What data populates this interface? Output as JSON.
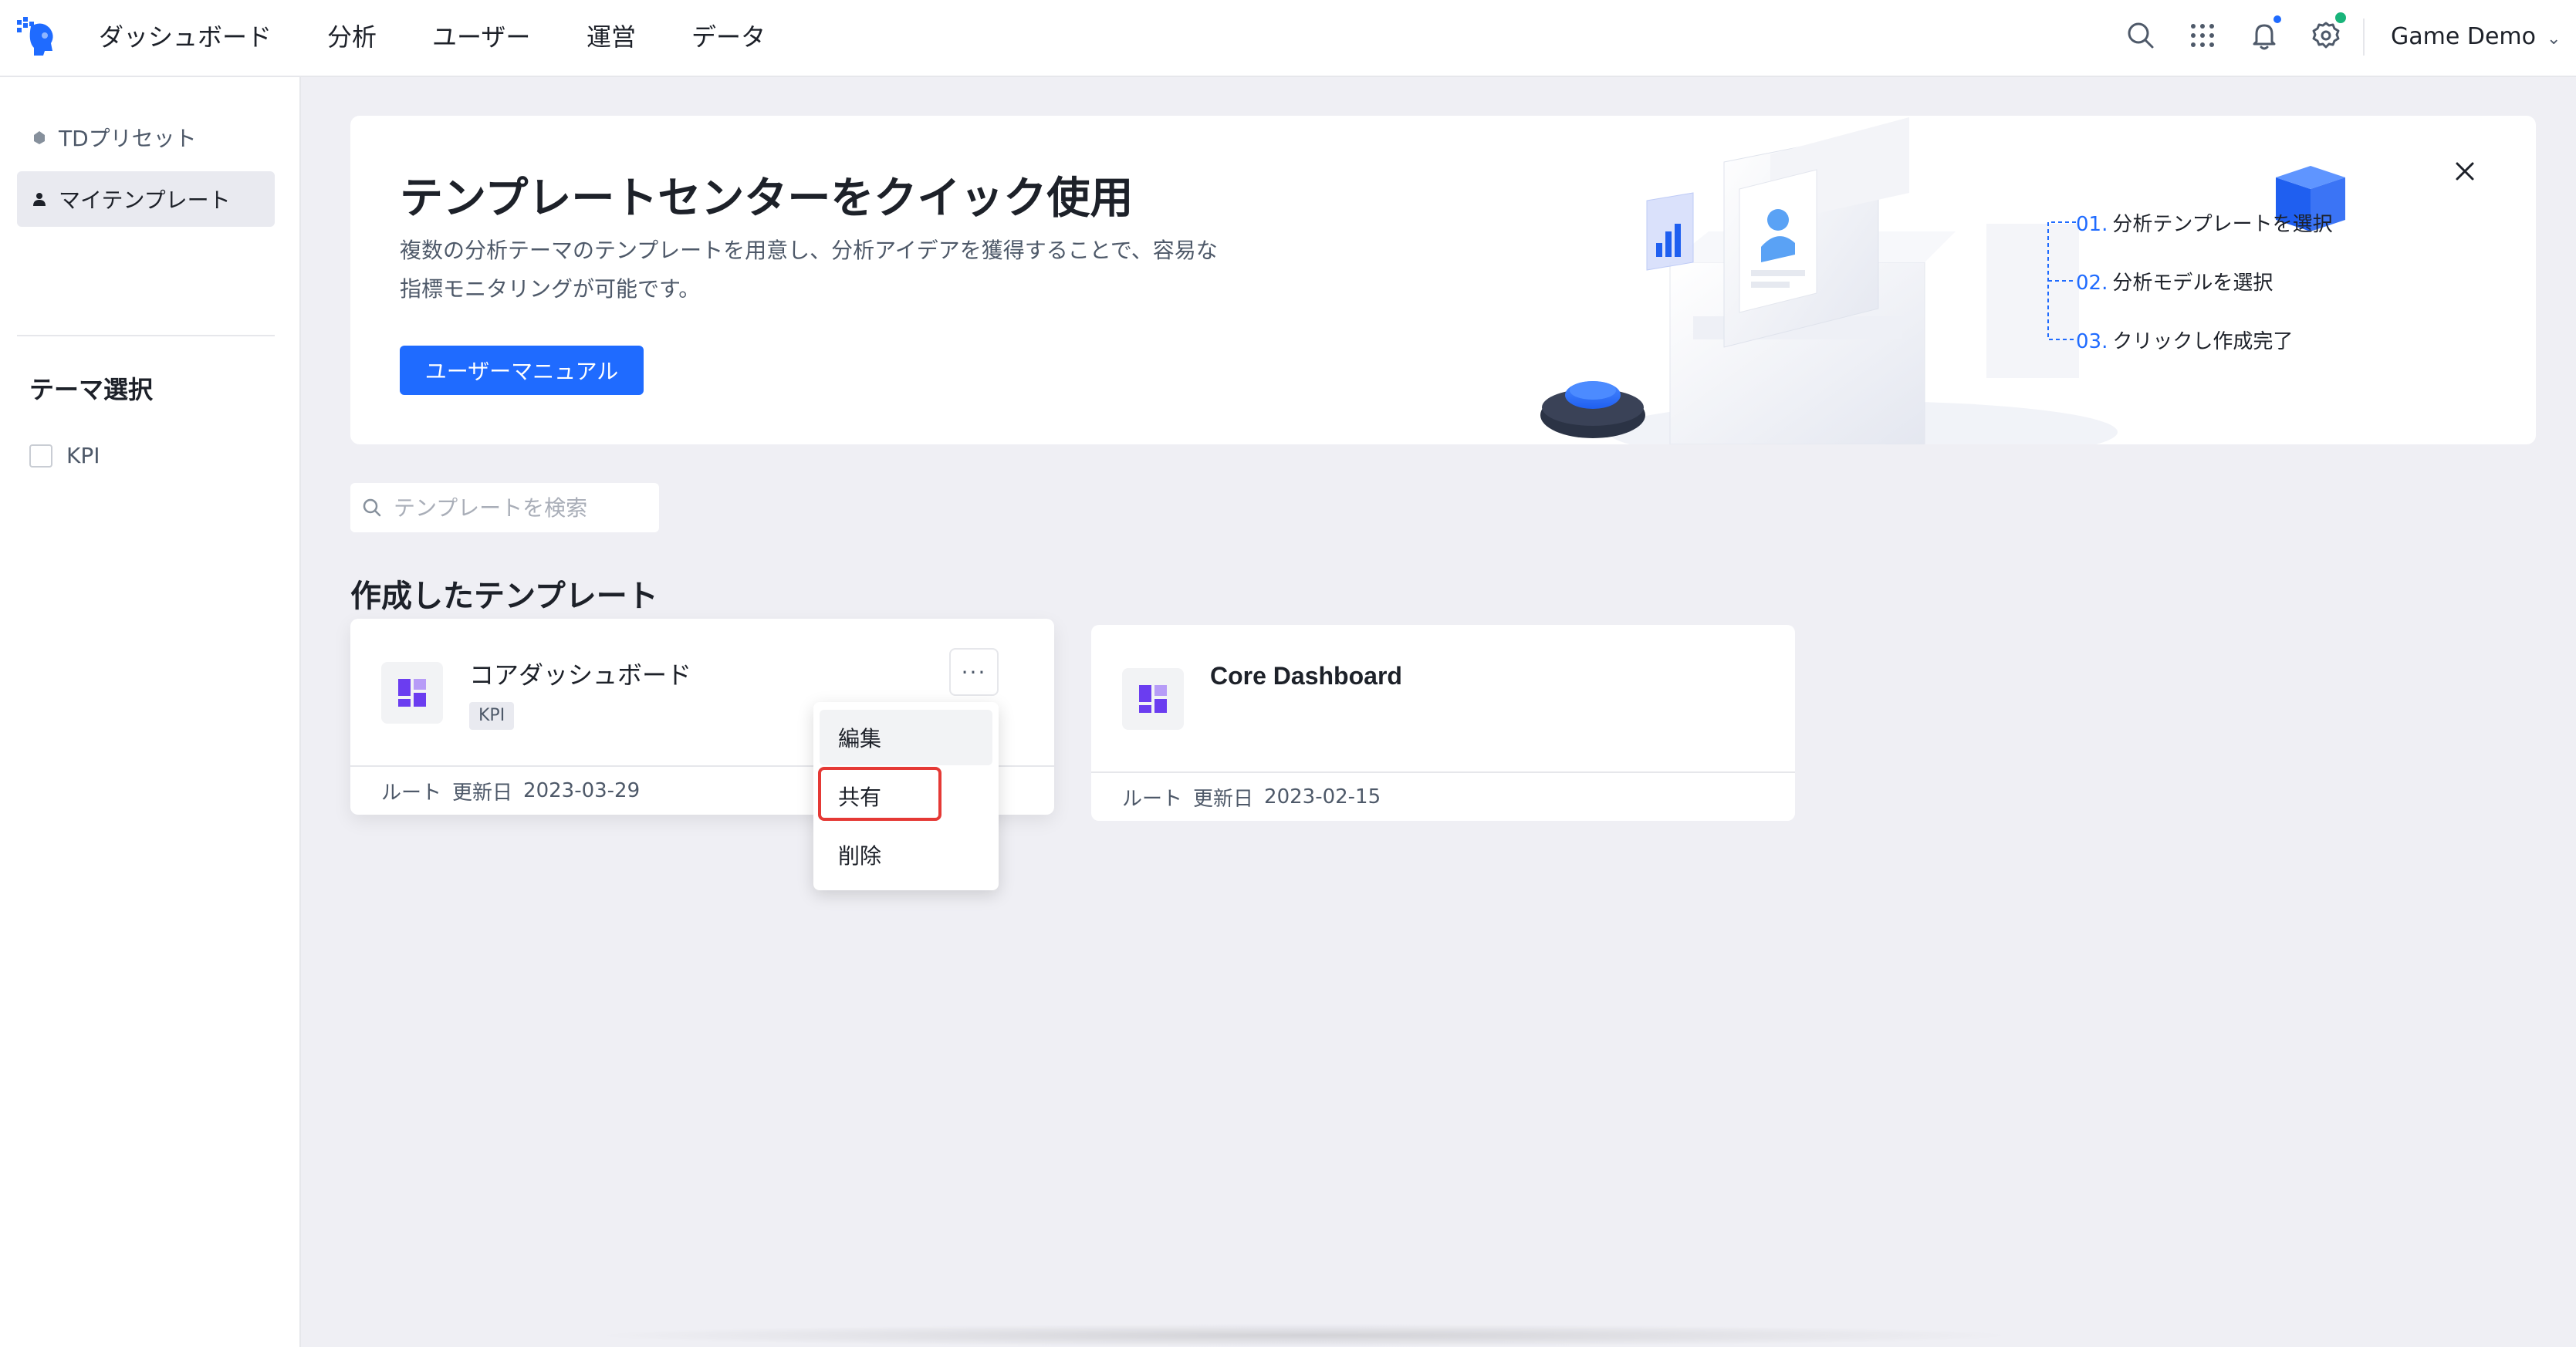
{
  "topbar": {
    "nav": [
      "ダッシュボード",
      "分析",
      "ユーザー",
      "運営",
      "データ"
    ],
    "user_name": "Game Demo",
    "icons": [
      "search-icon",
      "apps-grid-icon",
      "bell-icon",
      "settings-icon"
    ]
  },
  "sidebar": {
    "items": [
      {
        "label": "TDプリセット",
        "icon": "preset-icon"
      },
      {
        "label": "マイテンプレート",
        "icon": "person-icon"
      }
    ],
    "theme_heading": "テーマ選択",
    "theme_options": [
      {
        "label": "KPI",
        "checked": false
      }
    ]
  },
  "banner": {
    "title": "テンプレートセンターをクイック使用",
    "desc_line1": "複数の分析テーマのテンプレートを用意し、分析アイデアを獲得することで、容易な",
    "desc_line2": "指標モニタリングが可能です。",
    "button": "ユーザーマニュアル",
    "steps": [
      {
        "num": "01.",
        "text": "分析テンプレートを選択"
      },
      {
        "num": "02.",
        "text": "分析モデルを選択"
      },
      {
        "num": "03.",
        "text": "クリックし作成完了"
      }
    ]
  },
  "search": {
    "placeholder": "テンプレートを検索"
  },
  "section_title": "作成したテンプレート",
  "cards": [
    {
      "title": "コアダッシュボード",
      "tag": "KPI",
      "owner": "ルート",
      "updated_label": "更新日",
      "updated": "2023-03-29"
    },
    {
      "title": "Core Dashboard",
      "owner": "ルート",
      "updated_label": "更新日",
      "updated": "2023-02-15"
    }
  ],
  "dropdown": {
    "items": [
      "編集",
      "共有",
      "削除"
    ],
    "highlighted": "共有"
  },
  "colors": {
    "accent": "#1f6bff",
    "highlight": "#e53935",
    "card_icon": "#6b3df0"
  }
}
